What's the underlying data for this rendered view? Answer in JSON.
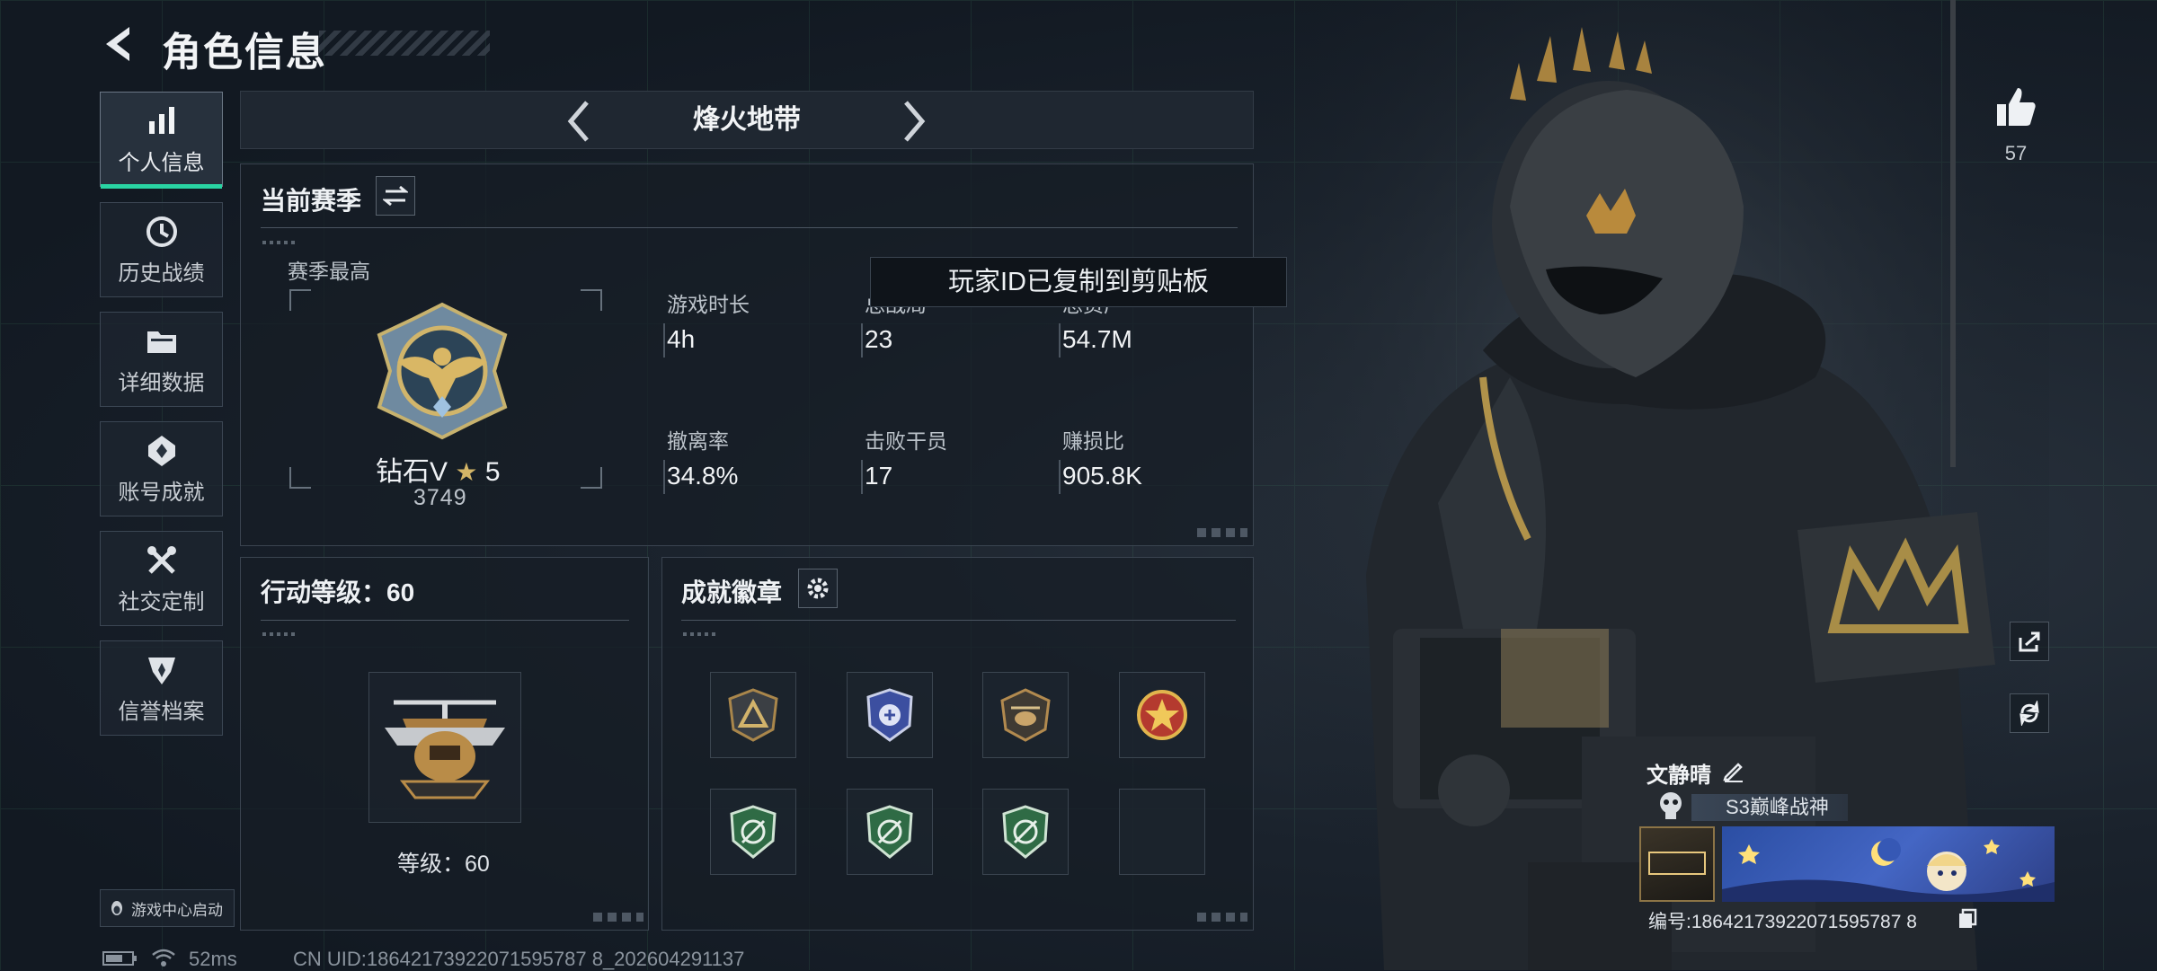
{
  "header": {
    "title": "角色信息"
  },
  "nav": [
    {
      "label": "个人信息",
      "icon": "bar-chart-icon",
      "active": true
    },
    {
      "label": "历史战绩",
      "icon": "history-icon",
      "active": false
    },
    {
      "label": "详细数据",
      "icon": "folder-icon",
      "active": false
    },
    {
      "label": "账号成就",
      "icon": "achievement-icon",
      "active": false
    },
    {
      "label": "社交定制",
      "icon": "tools-icon",
      "active": false
    },
    {
      "label": "信誉档案",
      "icon": "shield-rank-icon",
      "active": false
    }
  ],
  "mode": {
    "title": "烽火地带"
  },
  "season": {
    "title": "当前赛季",
    "best_label": "赛季最高",
    "rank_name": "钻石V",
    "rank_stars": "5",
    "rank_score": "3749",
    "stats": [
      {
        "label": "游戏时长",
        "value": "4h"
      },
      {
        "label": "总战局",
        "value": "23"
      },
      {
        "label": "总资产",
        "value": "54.7M"
      },
      {
        "label": "撤离率",
        "value": "34.8%"
      },
      {
        "label": "击败干员",
        "value": "17"
      },
      {
        "label": "赚损比",
        "value": "905.8K"
      }
    ]
  },
  "action_level": {
    "title": "行动等级：60",
    "level_text": "等级：60"
  },
  "achievements": {
    "title": "成就徽章"
  },
  "toast": {
    "text": "玩家ID已复制到剪贴板"
  },
  "likes": {
    "count": "57"
  },
  "profile": {
    "name": "文静晴",
    "title_badge": "S3巅峰战神",
    "id_text": "编号:18642173922071595787 8"
  },
  "footer": {
    "ping": "52ms",
    "uid": "CN UID:18642173922071595787 8_202604291137",
    "game_center": "游戏中心启动"
  }
}
